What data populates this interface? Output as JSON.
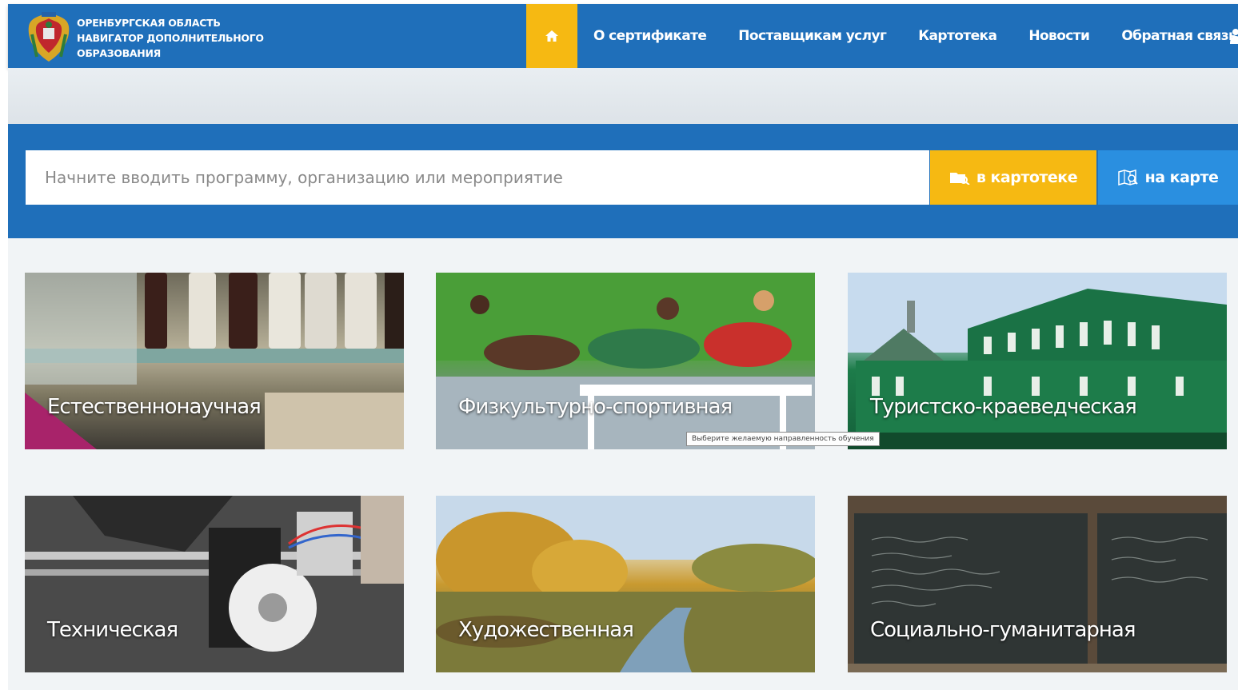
{
  "header": {
    "logo_lines": [
      "Оренбургская область",
      "навигатор дополнительного",
      "образования"
    ],
    "nav": [
      "О сертификате",
      "Поставщикам услуг",
      "Картотека",
      "Новости",
      "Обратная связь"
    ],
    "home_icon": "home-icon",
    "user_icon": "user-icon"
  },
  "search": {
    "placeholder": "Начните вводить программу, организацию или мероприятие",
    "catalog_button": "в картотеке",
    "map_button": "на карте"
  },
  "categories": [
    {
      "label": "Естественнонаучная"
    },
    {
      "label": "Физкультурно-спортивная"
    },
    {
      "label": "Туристско-краеведческая"
    },
    {
      "label": "Техническая"
    },
    {
      "label": "Художественная"
    },
    {
      "label": "Социально-гуманитарная"
    }
  ],
  "tooltip": "Выберите желаемую направленность обучения",
  "colors": {
    "primary": "#1f6fba",
    "accent": "#f6b912",
    "map_button": "#2a8fe0"
  }
}
